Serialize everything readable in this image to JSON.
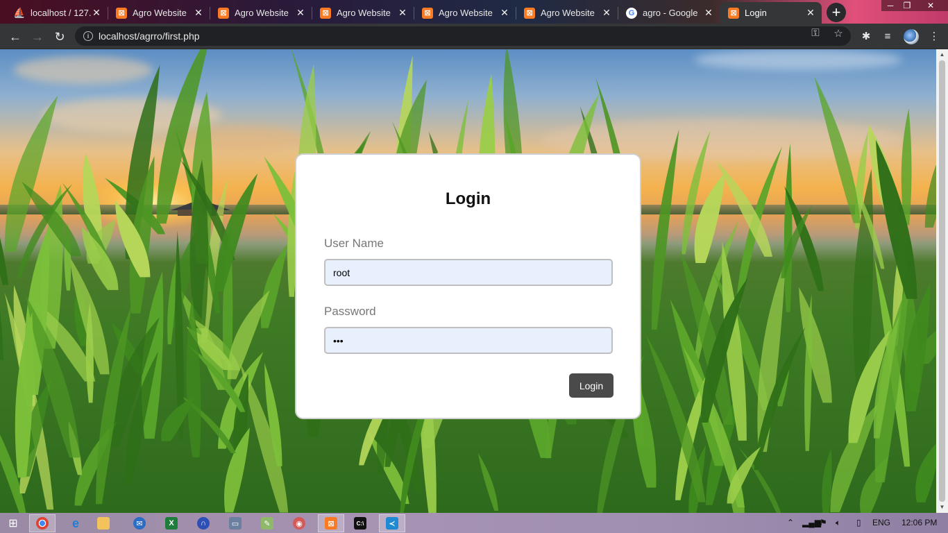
{
  "browser": {
    "tabs": [
      {
        "title": "localhost / 127.",
        "favicon": "phpmyadmin-icon",
        "active": false
      },
      {
        "title": "Agro Website",
        "favicon": "xampp-icon",
        "active": false
      },
      {
        "title": "Agro Website",
        "favicon": "xampp-icon",
        "active": false
      },
      {
        "title": "Agro Website",
        "favicon": "xampp-icon",
        "active": false
      },
      {
        "title": "Agro Website",
        "favicon": "xampp-icon",
        "active": false
      },
      {
        "title": "Agro Website",
        "favicon": "xampp-icon",
        "active": false
      },
      {
        "title": "agro - Google",
        "favicon": "google-icon",
        "active": false
      },
      {
        "title": "Login",
        "favicon": "xampp-icon",
        "active": true
      }
    ],
    "new_tab_symbol": "+",
    "url": "localhost/agrro/first.php"
  },
  "login_form": {
    "heading": "Login",
    "username_label": "User Name",
    "username_value": "root",
    "password_label": "Password",
    "password_value": "•••",
    "submit_label": "Login"
  },
  "taskbar": {
    "language": "ENG",
    "time": "12:06 PM"
  },
  "colors": {
    "tab_active": "#353638",
    "toolbar": "#353638",
    "omnibox": "#202124",
    "input_bg": "#e8f0fe",
    "button_bg": "#4a4a4a",
    "xampp_orange": "#fb7a24"
  }
}
